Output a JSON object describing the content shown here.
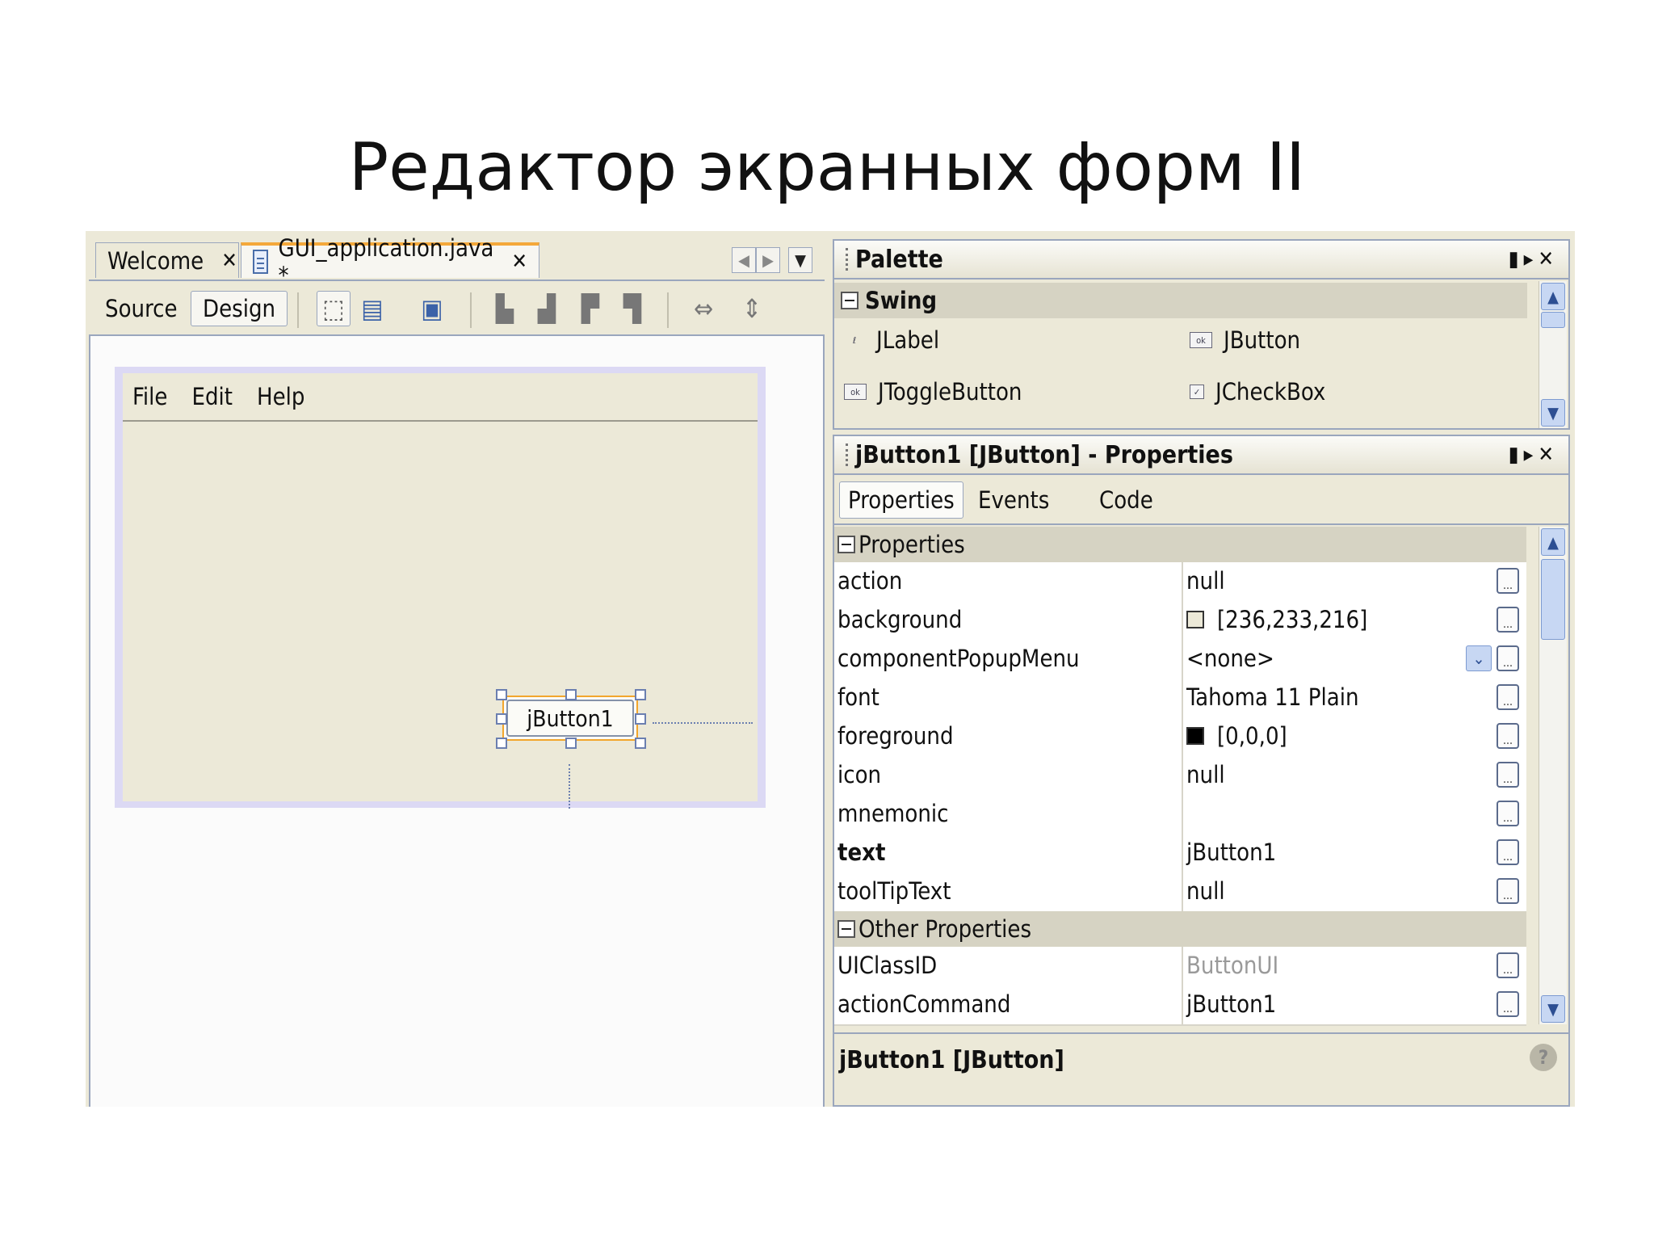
{
  "slide": {
    "title": "Редактор экранных форм II"
  },
  "editor": {
    "tabs": [
      {
        "label": "Welcome",
        "close": "✕"
      },
      {
        "label": "GUI_application.java *",
        "close": "✕"
      }
    ],
    "views": {
      "source": "Source",
      "design": "Design"
    },
    "form": {
      "menus": [
        "File",
        "Edit",
        "Help"
      ],
      "button_label": "jButton1"
    }
  },
  "palette": {
    "title": "Palette",
    "category": "Swing",
    "items": [
      "JLabel",
      "JButton",
      "JToggleButton",
      "JCheckBox"
    ]
  },
  "properties": {
    "title": "jButton1 [JButton] - Properties",
    "tabs": [
      "Properties",
      "Events",
      "Code"
    ],
    "section_main": "Properties",
    "rows": [
      {
        "name": "action",
        "value": "null"
      },
      {
        "name": "background",
        "value": "[236,233,216]",
        "swatch": "#ece9d8"
      },
      {
        "name": "componentPopupMenu",
        "value": "<none>"
      },
      {
        "name": "font",
        "value": "Tahoma 11 Plain"
      },
      {
        "name": "foreground",
        "value": "[0,0,0]",
        "swatch": "#000000"
      },
      {
        "name": "icon",
        "value": "null"
      },
      {
        "name": "mnemonic",
        "value": ""
      },
      {
        "name": "text",
        "value": "jButton1"
      },
      {
        "name": "toolTipText",
        "value": "null"
      }
    ],
    "section_other": "Other Properties",
    "other_rows": [
      {
        "name": "UIClassID",
        "value": "ButtonUI"
      },
      {
        "name": "actionCommand",
        "value": "jButton1"
      }
    ],
    "footer": "jButton1 [JButton]",
    "dots": "...",
    "help": "?"
  },
  "colors": {
    "accent_tab": "#f4a83a",
    "selection": "#f2a62d",
    "panel_bg": "#ece9d8"
  }
}
